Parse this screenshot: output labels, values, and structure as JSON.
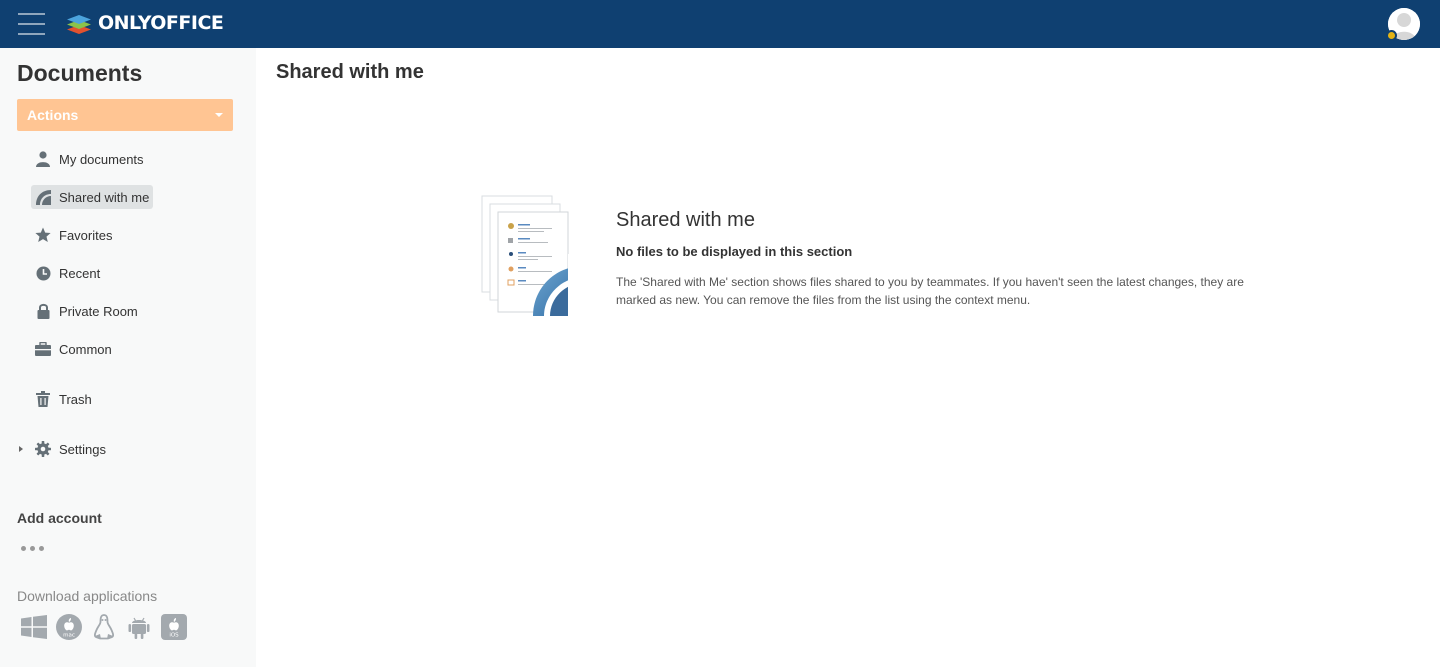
{
  "header": {
    "brand": "ONLYOFFICE",
    "accent_color": "#0f4071",
    "icons": [
      "menu-icon",
      "onlyoffice-logo",
      "user-avatar"
    ]
  },
  "sidebar": {
    "title": "Documents",
    "actions_label": "Actions",
    "actions_color": "#ffc593",
    "nav": [
      {
        "label": "My documents",
        "icon": "person-icon"
      },
      {
        "label": "Shared with me",
        "icon": "shared-icon",
        "active": true
      },
      {
        "label": "Favorites",
        "icon": "star-icon"
      },
      {
        "label": "Recent",
        "icon": "clock-icon"
      },
      {
        "label": "Private Room",
        "icon": "lock-icon"
      },
      {
        "label": "Common",
        "icon": "briefcase-icon"
      },
      {
        "label": "Trash",
        "icon": "trash-icon"
      },
      {
        "label": "Settings",
        "icon": "gear-icon"
      }
    ],
    "add_account": "Add account",
    "download_apps": "Download applications",
    "apps": [
      "windows-icon",
      "mac-icon",
      "linux-icon",
      "android-icon",
      "ios-icon"
    ],
    "app_labels": {
      "mac": "mac",
      "ios": "iOS"
    }
  },
  "main": {
    "title": "Shared with me",
    "empty": {
      "title": "Shared with me",
      "subtitle": "No files to be displayed in this section",
      "description": "The 'Shared with Me' section shows files shared to you by teammates. If you haven't seen the latest changes, they are marked as new. You can remove the files from the list using the context menu."
    }
  }
}
